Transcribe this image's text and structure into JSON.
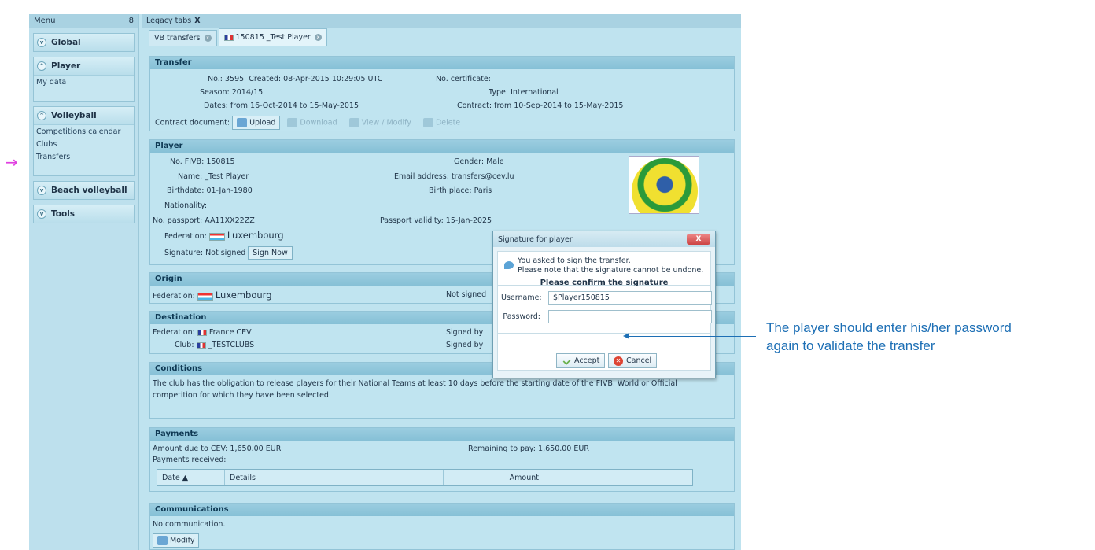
{
  "pointer_glyph": "→",
  "menu": {
    "title": "Menu",
    "pin": "8",
    "groups": [
      {
        "label": "Global"
      },
      {
        "label": "Player",
        "items": [
          "My data"
        ]
      },
      {
        "label": "Volleyball",
        "items": [
          "Competitions calendar",
          "Clubs",
          "Transfers"
        ]
      },
      {
        "label": "Beach volleyball"
      },
      {
        "label": "Tools"
      }
    ]
  },
  "header": {
    "legacy_title": "Legacy tabs",
    "legacy_close": "X",
    "tabs": [
      "VB transfers",
      "150815 _Test Player"
    ]
  },
  "transfer": {
    "title": "Transfer",
    "no_label": "No.:",
    "no": "3595",
    "created_label": "Created:",
    "created": "08-Apr-2015 10:29:05 UTC",
    "cert_label": "No. certificate:",
    "season_label": "Season:",
    "season": "2014/15",
    "type_label": "Type:",
    "type": "International",
    "dates_label": "Dates:",
    "dates": "from 16-Oct-2014  to 15-May-2015",
    "contract_label": "Contract:",
    "contract": "from 10-Sep-2014  to 15-May-2015",
    "doc_label": "Contract document:",
    "upload": "Upload",
    "download": "Download",
    "view": "View / Modify",
    "delete": "Delete"
  },
  "player": {
    "title": "Player",
    "fivb_label": "No. FIVB:",
    "fivb": "150815",
    "gender_label": "Gender:",
    "gender": "Male",
    "name_label": "Name:",
    "name": "_Test Player",
    "email_label": "Email address:",
    "email": "transfers@cev.lu",
    "birth_label": "Birthdate:",
    "birth": "01-Jan-1980",
    "birthplace_label": "Birth place:",
    "birthplace": "Paris",
    "nat_label": "Nationality:",
    "passport_label": "No. passport:",
    "passport": "AA11XX22ZZ",
    "validity_label": "Passport validity:",
    "validity": "15-Jan-2025",
    "fed_label": "Federation:",
    "fed": "Luxembourg",
    "sig_label": "Signature:",
    "sig": "Not signed",
    "sign_now": "Sign Now"
  },
  "origin": {
    "title": "Origin",
    "fed_label": "Federation:",
    "fed": "Luxembourg",
    "status": "Not signed"
  },
  "destination": {
    "title": "Destination",
    "fed_label": "Federation:",
    "fed": "France  CEV",
    "club_label": "Club:",
    "club": "_TESTCLUBS",
    "signed1": "Signed by",
    "signed2": "Signed by"
  },
  "conditions": {
    "title": "Conditions",
    "text1": "The club has the obligation to release players for their National Teams at least 10 days before the starting date of the FIVB, World or Official",
    "text2": "competition for which they have been selected"
  },
  "payments": {
    "title": "Payments",
    "due_label": "Amount due to CEV:",
    "due": "1,650.00 EUR",
    "remain_label": "Remaining to pay:",
    "remain": "1,650.00 EUR",
    "received": "Payments received:",
    "columns": [
      "Date ▲",
      "Details",
      "Amount"
    ]
  },
  "communications": {
    "title": "Communications",
    "text": "No communication.",
    "modify": "Modify"
  },
  "dialog": {
    "title": "Signature for player",
    "close": "X",
    "line1": "You asked to sign the transfer.",
    "line2": "Please note that the signature cannot be undone.",
    "confirm": "Please confirm the signature",
    "user_label": "Username:",
    "user_value": "$Player150815",
    "pass_label": "Password:",
    "pass_value": "",
    "accept": "Accept",
    "cancel": "Cancel"
  },
  "annotation": {
    "line1": "The player should enter his/her password",
    "line2": "again to validate the transfer"
  }
}
